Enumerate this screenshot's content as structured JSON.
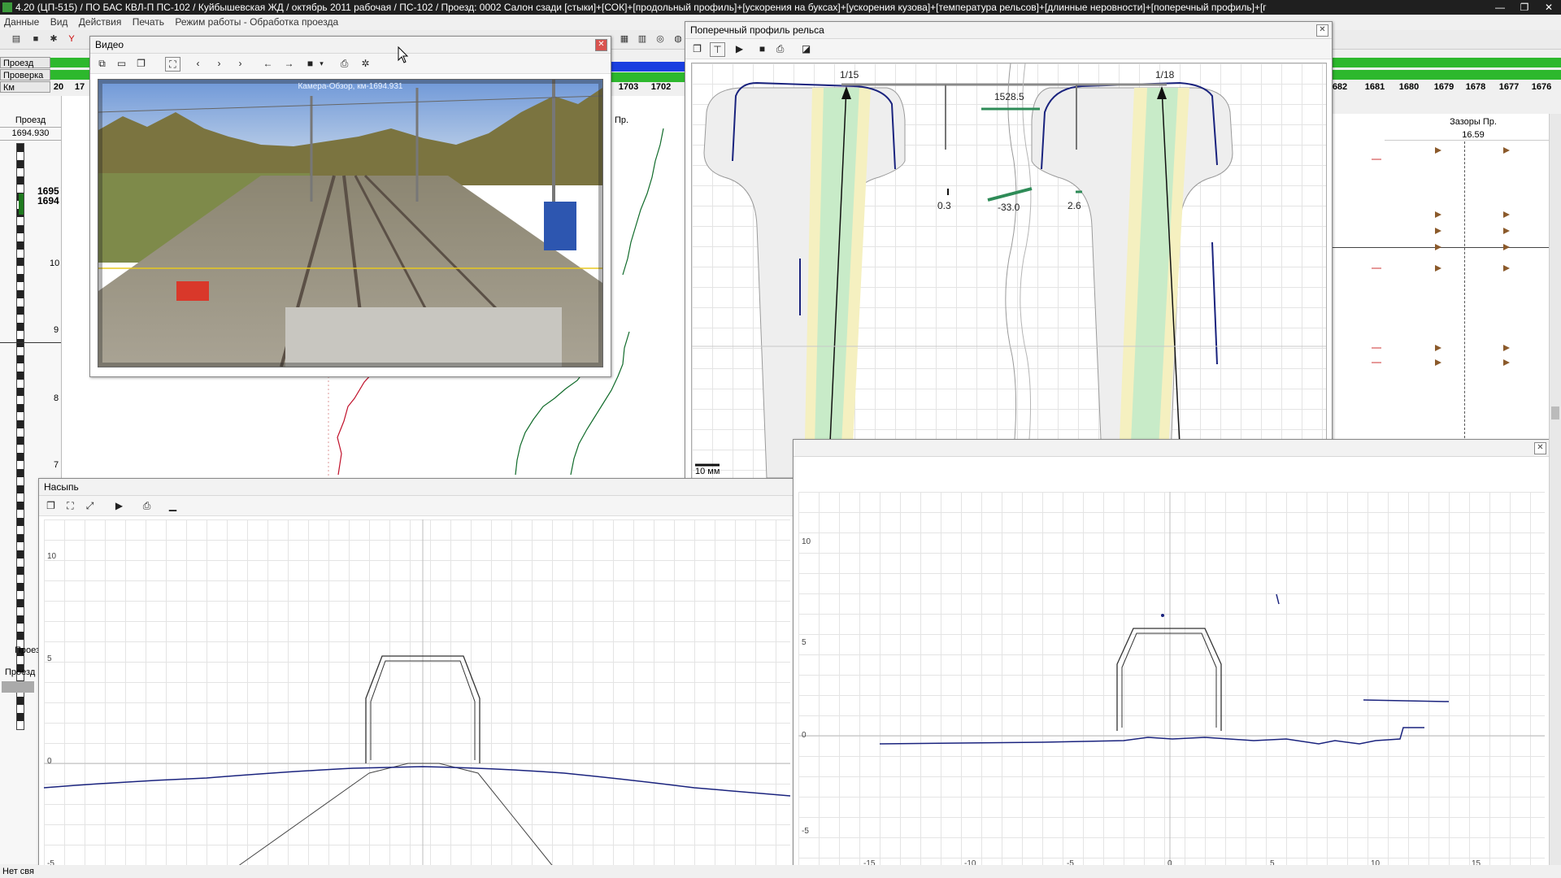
{
  "app": {
    "title": "4.20 (ЦП-515) / ПО БАС КВЛ-П ПС-102 / Куйбышевская ЖД / октябрь 2011 рабочая / ПС-102 / Проезд: 0002 Салон сзади [стыки]+[СОК]+[продольный профиль]+[ускорения на буксах]+[ускорения кузова]+[температура рельсов]+[длинные неровности]+[поперечный профиль]+[г",
    "window_buttons": [
      "—",
      "❐",
      "✕"
    ]
  },
  "menu": [
    "Данные",
    "Вид",
    "Действия",
    "Печать",
    "Режим работы - Обработка проезда"
  ],
  "tracks": {
    "row1_label": "Проезд",
    "row2_label": "Проверка",
    "row3_label": "Км",
    "km_left": [
      "20",
      "17"
    ],
    "km_mid": [
      "1703",
      "1702"
    ],
    "km_right": [
      "682",
      "1681",
      "1680",
      "1679",
      "1678",
      "1677",
      "1676"
    ]
  },
  "left_panel": {
    "header": "Проезд",
    "value": "1694.930",
    "km_marks": [
      "1695",
      "1694"
    ],
    "side_numbers": [
      "10",
      "9",
      "8",
      "7"
    ],
    "lower_labels": [
      "Проез",
      "Проезд"
    ],
    "status": "Нет свя"
  },
  "behind": {
    "col_label": "Пр.",
    "gaps_title": "Зазоры Пр.",
    "gaps_value": "16.59"
  },
  "video": {
    "title": "Видео",
    "caption": "Камера-Обзор, км-1694.931"
  },
  "profile": {
    "title": "Поперечный профиль рельса",
    "left_tag": "1/15",
    "right_tag": "1/18",
    "gauge": "1528.5",
    "left_val": "0.3",
    "mid_val": "-33.0",
    "right_val": "2.6",
    "scale": "10 мм"
  },
  "nasyp": {
    "title": "Насыпь",
    "y_ticks": [
      "10",
      "5",
      "0",
      "-5"
    ]
  },
  "right_graph": {
    "y_ticks": [
      "10",
      "5",
      "0",
      "-5"
    ],
    "x_ticks": [
      "-15",
      "-10",
      "-5",
      "0",
      "5",
      "10",
      "15"
    ]
  },
  "colors": {
    "titlebar": "#1f1f1f",
    "progress_green": "#2db82d",
    "progress_blue": "#1a3fe0",
    "profile_line": "#1a237e",
    "green_zone": "#c8ebc8",
    "yellow_zone": "#f5f0c0"
  }
}
